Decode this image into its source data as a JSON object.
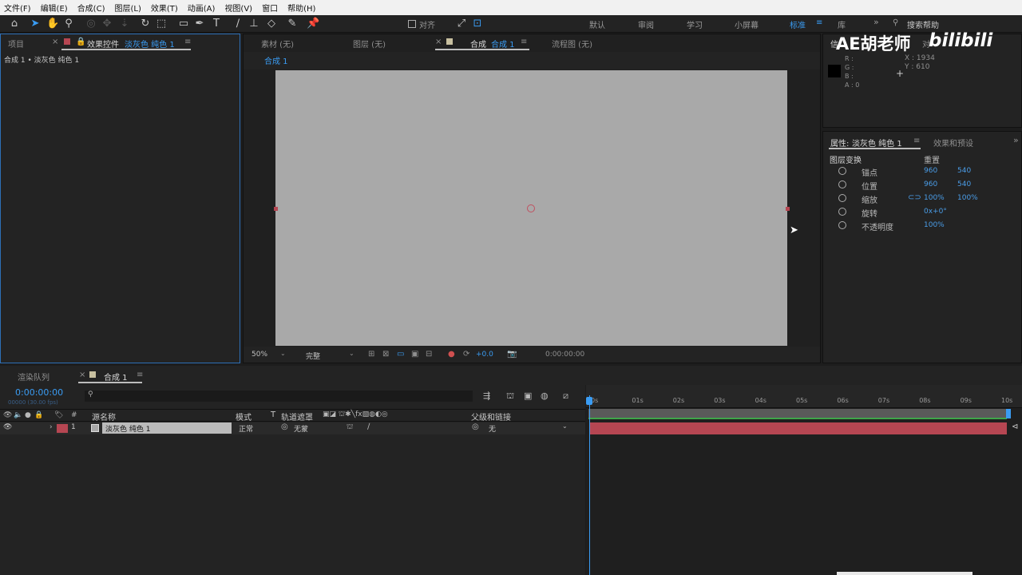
{
  "menu": [
    "文件(F)",
    "编辑(E)",
    "合成(C)",
    "图层(L)",
    "效果(T)",
    "动画(A)",
    "视图(V)",
    "窗口",
    "帮助(H)"
  ],
  "toolbar": {
    "align_label": "对齐",
    "workspaces": [
      "默认",
      "审阅",
      "学习",
      "小屏幕",
      "标准",
      "库"
    ],
    "active_workspace": "标准",
    "search_placeholder": "搜索帮助"
  },
  "left_panel": {
    "tab_project": "项目",
    "tab_effects_prefix": "效果控件",
    "tab_effects_layer": "淡灰色 纯色 1",
    "breadcrumb": "合成 1 • 淡灰色 纯色 1"
  },
  "viewer": {
    "tab_footage": "素材 (无)",
    "tab_layer": "图层 (无)",
    "tab_comp_prefix": "合成",
    "tab_comp_name": "合成 1",
    "tab_flow": "流程图 (无)",
    "comp_crumb": "合成 1",
    "zoom": "50%",
    "quality": "完整",
    "exposure": "+0.0",
    "timecode": "0:00:00:00",
    "canvas_color": "#a9a9a9"
  },
  "info_panel": {
    "tab_info": "信",
    "tab_align": "对",
    "watermark_text": "AE胡老师",
    "watermark_logo": "bilibili",
    "r_label": "R :",
    "g_label": "G :",
    "b_label": "B :",
    "a_label": "A : 0",
    "x_readout": "X : 1934",
    "y_readout": "Y : 610"
  },
  "properties_panel": {
    "tab_props_prefix": "属性:",
    "tab_props_layer": "淡灰色 纯色 1",
    "tab_effects_presets": "效果和预设",
    "section_title": "图层变换",
    "reset_label": "重置",
    "rows": [
      {
        "label": "锚点",
        "v1": "960",
        "v2": "540"
      },
      {
        "label": "位置",
        "v1": "960",
        "v2": "540"
      },
      {
        "label": "缩放",
        "v1": "100%",
        "v2": "100%"
      },
      {
        "label": "旋转",
        "v1": "0x+0°",
        "v2": ""
      },
      {
        "label": "不透明度",
        "v1": "100%",
        "v2": ""
      }
    ]
  },
  "bottom_tabs": {
    "render_queue": "渲染队列",
    "comp_tab": "合成 1"
  },
  "timeline": {
    "timecode": "0:00:00:00",
    "fps_hint": "00000 (30.00 fps)",
    "col_source_name": "源名称",
    "col_mode": "模式",
    "col_t": "T",
    "col_trackmatte": "轨道遮罩",
    "col_parent": "父级和链接",
    "layer_index": "1",
    "layer_name": "淡灰色 纯色 1",
    "layer_mode": "正常",
    "layer_matte": "无蒙",
    "layer_parent": "无",
    "ruler": [
      "0s",
      "01s",
      "02s",
      "03s",
      "04s",
      "05s",
      "06s",
      "07s",
      "08s",
      "09s",
      "10s"
    ],
    "layer_bar_color": "#b64652",
    "workarea_color": "#3fa64a"
  }
}
